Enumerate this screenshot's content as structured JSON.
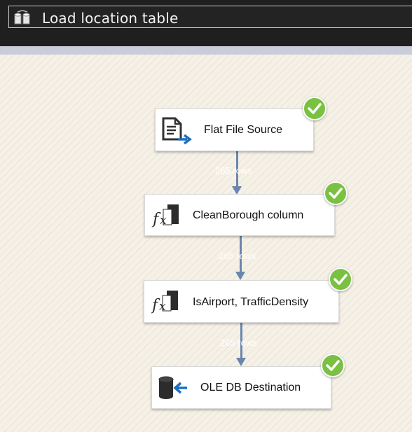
{
  "header": {
    "title": "Load location table"
  },
  "nodes": [
    {
      "label": "Flat File Source",
      "icon": "flat-file-source-icon",
      "status": "success"
    },
    {
      "label": "CleanBorough column",
      "icon": "derived-column-icon",
      "status": "success"
    },
    {
      "label": "IsAirport, TrafficDensity",
      "icon": "derived-column-icon",
      "status": "success"
    },
    {
      "label": "OLE DB Destination",
      "icon": "ole-db-destination-icon",
      "status": "success"
    }
  ],
  "paths": [
    {
      "rows_label": "265 rows"
    },
    {
      "rows_label": "265 rows"
    },
    {
      "rows_label": "265 rows"
    }
  ],
  "colors": {
    "success": "#7ac142",
    "connector": "#6b86ad",
    "canvas": "#f6f1e7"
  }
}
